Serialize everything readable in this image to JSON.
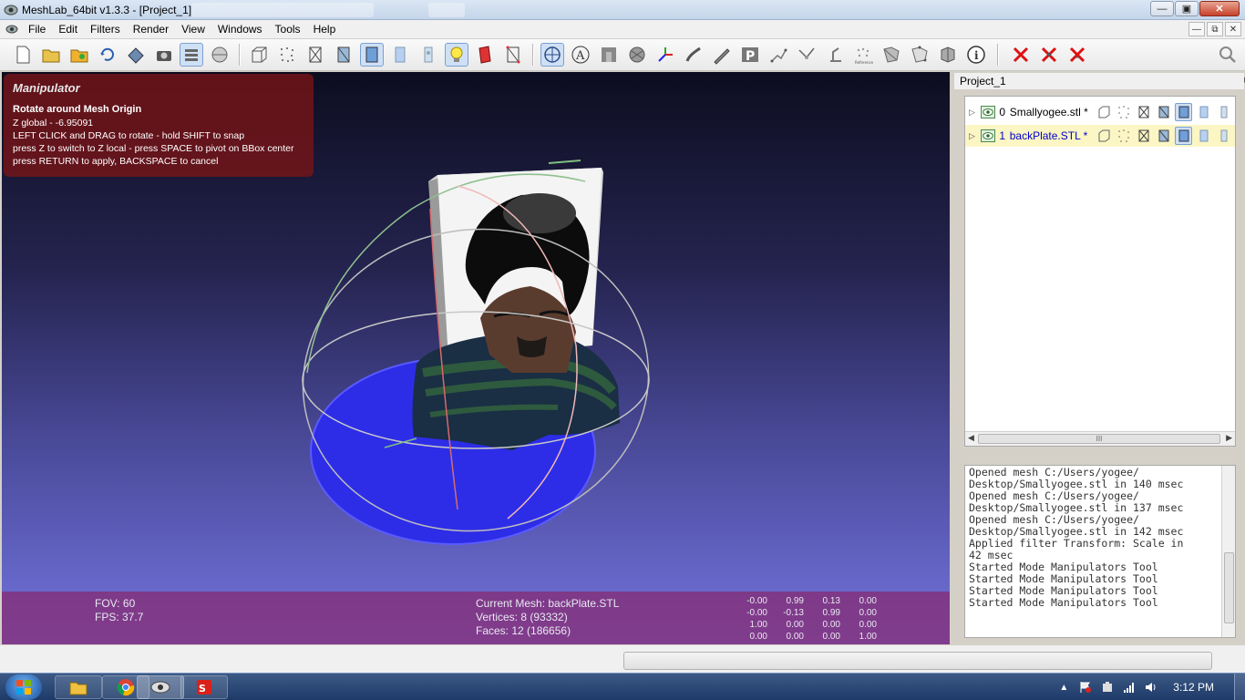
{
  "window": {
    "title": "MeshLab_64bit v1.3.3 - [Project_1]"
  },
  "menubar": {
    "items": [
      "File",
      "Edit",
      "Filters",
      "Render",
      "View",
      "Windows",
      "Tools",
      "Help"
    ]
  },
  "toolbar": {
    "icons": [
      "new-file-icon",
      "open-folder-icon",
      "open-project-icon",
      "reload-icon",
      "save-icon",
      "snapshot-icon",
      "layers-icon",
      "sphere-icon",
      "bounding-box-icon",
      "points-icon",
      "wireframe-icon",
      "hidden-lines-icon",
      "flat-icon",
      "smooth-icon",
      "texture-icon",
      "light-icon",
      "color-icon",
      "selection-mode-icon",
      "manipulator-icon",
      "annotation-icon",
      "shading-icon",
      "paint-icon",
      "axis-icon",
      "brush-icon",
      "pen-icon",
      "p-tool-icon",
      "align-icon",
      "pick-points-icon",
      "measure-icon",
      "reference-icon",
      "select-faces-icon",
      "select-vertices-icon",
      "info-icon",
      "delete-red-1-icon",
      "delete-red-2-icon",
      "delete-red-3-icon",
      "search-icon"
    ]
  },
  "viewport": {
    "manipulator": {
      "title": "Manipulator",
      "subtitle": "Rotate around Mesh Origin",
      "lines": [
        "Z global - -6.95091",
        "LEFT CLICK and DRAG to rotate - hold SHIFT to snap",
        "press Z to switch to Z local - press SPACE to pivot on BBox center",
        "press RETURN to apply, BACKSPACE to cancel"
      ]
    },
    "info": {
      "fov": "FOV: 60",
      "fps": "FPS:   37.7",
      "current_mesh": "Current Mesh: backPlate.STL",
      "vertices": "Vertices: 8 (93332)",
      "faces": "Faces: 12 (186656)",
      "matrix": [
        [
          "-0.00",
          "0.99",
          "0.13",
          "0.00"
        ],
        [
          "-0.00",
          "-0.13",
          "0.99",
          "0.00"
        ],
        [
          "1.00",
          "0.00",
          "0.00",
          "0.00"
        ],
        [
          "0.00",
          "0.00",
          "0.00",
          "1.00"
        ]
      ]
    }
  },
  "layer_panel": {
    "title": "Project_1",
    "layers": [
      {
        "index": "0",
        "name": "Smallyogee.stl *",
        "selected": false
      },
      {
        "index": "1",
        "name": "backPlate.STL *",
        "selected": true
      }
    ],
    "scroll_thumb": "III"
  },
  "log": {
    "lines": [
      "Opened mesh C:/Users/yogee/",
      "Desktop/Smallyogee.stl in 140 msec",
      "Opened mesh C:/Users/yogee/",
      "Desktop/Smallyogee.stl in 137 msec",
      "Opened mesh C:/Users/yogee/",
      "Desktop/Smallyogee.stl in 142 msec",
      "Applied filter Transform: Scale in",
      "42 msec",
      "Started Mode Manipulators Tool",
      "Started Mode Manipulators Tool",
      "Started Mode Manipulators Tool",
      "Started Mode Manipulators Tool"
    ]
  },
  "taskbar": {
    "clock": "3:12 PM",
    "apps": [
      "windows-explorer-icon",
      "chrome-icon",
      "meshlab-icon",
      "solidworks-icon"
    ]
  }
}
